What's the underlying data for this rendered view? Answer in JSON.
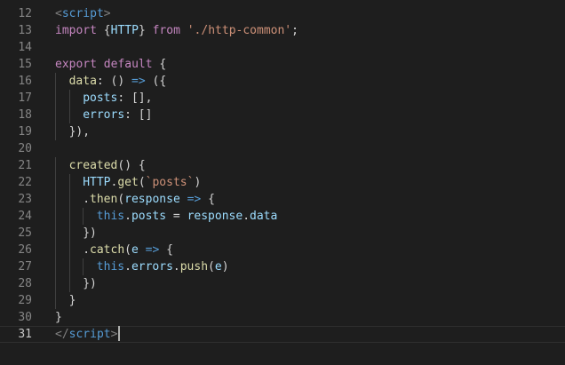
{
  "editor": {
    "cursor_line": 31,
    "lines": [
      {
        "n": "12",
        "indent": 0,
        "tokens": [
          [
            "tag",
            "<"
          ],
          [
            "tagname",
            "script"
          ],
          [
            "tag",
            ">"
          ]
        ]
      },
      {
        "n": "13",
        "indent": 0,
        "tokens": [
          [
            "kw",
            "import"
          ],
          [
            "punc",
            " {"
          ],
          [
            "var",
            "HTTP"
          ],
          [
            "punc",
            "} "
          ],
          [
            "kw",
            "from"
          ],
          [
            "punc",
            " "
          ],
          [
            "str",
            "'./http-common'"
          ],
          [
            "punc",
            ";"
          ]
        ]
      },
      {
        "n": "14",
        "indent": 0,
        "tokens": []
      },
      {
        "n": "15",
        "indent": 0,
        "tokens": [
          [
            "kw",
            "export"
          ],
          [
            "punc",
            " "
          ],
          [
            "kw",
            "default"
          ],
          [
            "punc",
            " {"
          ]
        ]
      },
      {
        "n": "16",
        "indent": 1,
        "tokens": [
          [
            "fn",
            "data"
          ],
          [
            "punc",
            ": () "
          ],
          [
            "op",
            "=>"
          ],
          [
            "punc",
            " ({"
          ]
        ]
      },
      {
        "n": "17",
        "indent": 2,
        "tokens": [
          [
            "var",
            "posts"
          ],
          [
            "punc",
            ": [],"
          ]
        ]
      },
      {
        "n": "18",
        "indent": 2,
        "tokens": [
          [
            "var",
            "errors"
          ],
          [
            "punc",
            ": []"
          ]
        ]
      },
      {
        "n": "19",
        "indent": 1,
        "tokens": [
          [
            "punc",
            "}),"
          ]
        ]
      },
      {
        "n": "20",
        "indent": 0,
        "tokens": []
      },
      {
        "n": "21",
        "indent": 1,
        "tokens": [
          [
            "fn",
            "created"
          ],
          [
            "punc",
            "() {"
          ]
        ]
      },
      {
        "n": "22",
        "indent": 2,
        "tokens": [
          [
            "var",
            "HTTP"
          ],
          [
            "punc",
            "."
          ],
          [
            "fn",
            "get"
          ],
          [
            "punc",
            "("
          ],
          [
            "str",
            "`posts`"
          ],
          [
            "punc",
            ")"
          ]
        ]
      },
      {
        "n": "23",
        "indent": 2,
        "tokens": [
          [
            "punc",
            "."
          ],
          [
            "fn",
            "then"
          ],
          [
            "punc",
            "("
          ],
          [
            "var",
            "response"
          ],
          [
            "punc",
            " "
          ],
          [
            "op",
            "=>"
          ],
          [
            "punc",
            " {"
          ]
        ]
      },
      {
        "n": "24",
        "indent": 3,
        "tokens": [
          [
            "kwb",
            "this"
          ],
          [
            "punc",
            "."
          ],
          [
            "var",
            "posts"
          ],
          [
            "punc",
            " = "
          ],
          [
            "var",
            "response"
          ],
          [
            "punc",
            "."
          ],
          [
            "var",
            "data"
          ]
        ]
      },
      {
        "n": "25",
        "indent": 2,
        "tokens": [
          [
            "punc",
            "})"
          ]
        ]
      },
      {
        "n": "26",
        "indent": 2,
        "tokens": [
          [
            "punc",
            "."
          ],
          [
            "fn",
            "catch"
          ],
          [
            "punc",
            "("
          ],
          [
            "var",
            "e"
          ],
          [
            "punc",
            " "
          ],
          [
            "op",
            "=>"
          ],
          [
            "punc",
            " {"
          ]
        ]
      },
      {
        "n": "27",
        "indent": 3,
        "tokens": [
          [
            "kwb",
            "this"
          ],
          [
            "punc",
            "."
          ],
          [
            "var",
            "errors"
          ],
          [
            "punc",
            "."
          ],
          [
            "fn",
            "push"
          ],
          [
            "punc",
            "("
          ],
          [
            "var",
            "e"
          ],
          [
            "punc",
            ")"
          ]
        ]
      },
      {
        "n": "28",
        "indent": 2,
        "tokens": [
          [
            "punc",
            "})"
          ]
        ]
      },
      {
        "n": "29",
        "indent": 1,
        "tokens": [
          [
            "punc",
            "}"
          ]
        ]
      },
      {
        "n": "30",
        "indent": 0,
        "tokens": [
          [
            "punc",
            "}"
          ]
        ]
      },
      {
        "n": "31",
        "indent": 0,
        "tokens": [
          [
            "tag",
            "</"
          ],
          [
            "tagname",
            "script"
          ],
          [
            "tag",
            ">"
          ]
        ]
      }
    ]
  }
}
